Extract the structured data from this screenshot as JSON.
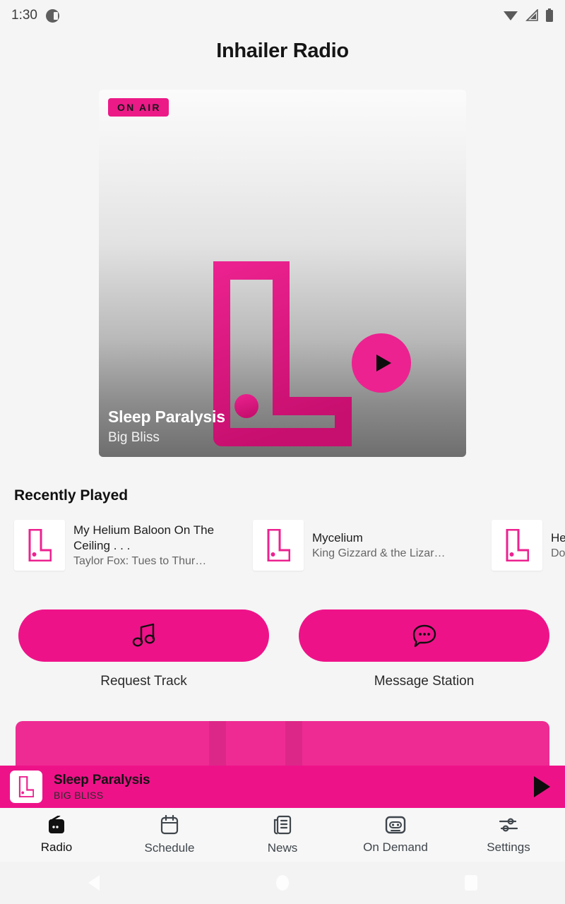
{
  "status_bar": {
    "time": "1:30",
    "left_icon": "contrast-circle-icon",
    "icons": [
      "wifi-icon",
      "cellular-signal-icon",
      "battery-icon"
    ]
  },
  "header": {
    "title": "Inhailer Radio"
  },
  "hero": {
    "badge": "ON AIR",
    "track_title": "Sleep Paralysis",
    "artist": "Big Bliss",
    "logo": "inhailer-l-logo",
    "play_overlay": "play-icon"
  },
  "recently_played": {
    "heading": "Recently Played",
    "items": [
      {
        "title": "My Helium Baloon On The Ceiling . . .",
        "subtitle": "Taylor Fox: Tues to Thur…"
      },
      {
        "title": "Mycelium",
        "subtitle": "King Gizzard & the Lizar…"
      },
      {
        "title": "He",
        "subtitle": "Do"
      }
    ]
  },
  "actions": [
    {
      "label": "Request Track",
      "icon": "music-note-icon"
    },
    {
      "label": "Message Station",
      "icon": "chat-bubble-icon"
    }
  ],
  "now_playing": {
    "title": "Sleep Paralysis",
    "artist": "BIG BLISS",
    "play_button": "play-icon"
  },
  "bottom_nav": [
    {
      "label": "Radio",
      "icon": "radio-icon",
      "active": true
    },
    {
      "label": "Schedule",
      "icon": "calendar-icon",
      "active": false
    },
    {
      "label": "News",
      "icon": "newspaper-icon",
      "active": false
    },
    {
      "label": "On Demand",
      "icon": "cassette-icon",
      "active": false
    },
    {
      "label": "Settings",
      "icon": "sliders-icon",
      "active": false
    }
  ],
  "android_nav": [
    "back-icon",
    "home-icon",
    "recents-icon"
  ],
  "colors": {
    "accent_pink": "#ee1289",
    "badge_pink": "#ec1a87",
    "page_background": "#f5f5f5",
    "text_primary": "#151515"
  }
}
